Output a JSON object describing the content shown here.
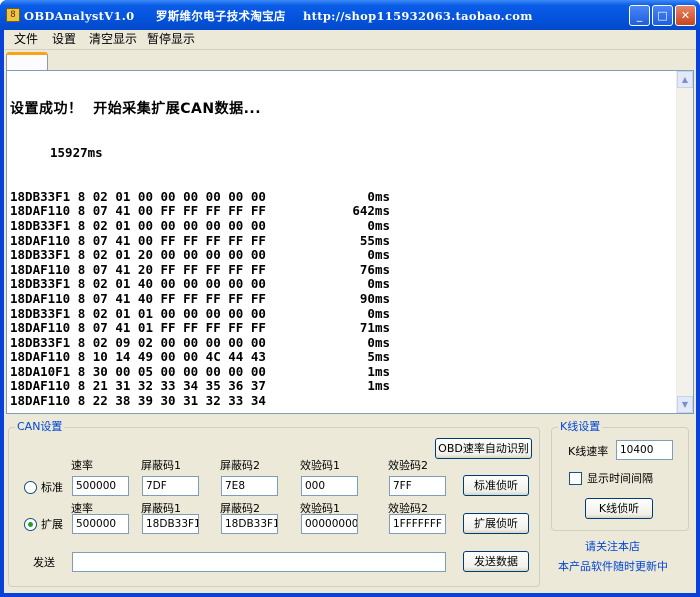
{
  "window": {
    "title": "OBDAnalystV1.0     罗斯维尔电子技术淘宝店    http://shop115932063.taobao.com",
    "min_glyph": "_",
    "max_glyph": "□",
    "close_glyph": "✕",
    "icon_glyph": "8"
  },
  "menu": {
    "items": [
      "文件",
      "设置",
      "清空显示",
      "暂停显示"
    ]
  },
  "log": {
    "header": "设置成功！  开始采集扩展CAN数据...",
    "first_time": "15927ms",
    "lines": [
      {
        "frame": "18DB33F1 8 02 01 00 00 00 00 00 00",
        "time": "0ms"
      },
      {
        "frame": "18DAF110 8 07 41 00 FF FF FF FF FF",
        "time": "642ms"
      },
      {
        "frame": "18DB33F1 8 02 01 00 00 00 00 00 00",
        "time": "0ms"
      },
      {
        "frame": "18DAF110 8 07 41 00 FF FF FF FF FF",
        "time": "55ms"
      },
      {
        "frame": "18DB33F1 8 02 01 20 00 00 00 00 00",
        "time": "0ms"
      },
      {
        "frame": "18DAF110 8 07 41 20 FF FF FF FF FF",
        "time": "76ms"
      },
      {
        "frame": "18DB33F1 8 02 01 40 00 00 00 00 00",
        "time": "0ms"
      },
      {
        "frame": "18DAF110 8 07 41 40 FF FF FF FF FF",
        "time": "90ms"
      },
      {
        "frame": "18DB33F1 8 02 01 01 00 00 00 00 00",
        "time": "0ms"
      },
      {
        "frame": "18DAF110 8 07 41 01 FF FF FF FF FF",
        "time": "71ms"
      },
      {
        "frame": "18DB33F1 8 02 09 02 00 00 00 00 00",
        "time": "0ms"
      },
      {
        "frame": "18DAF110 8 10 14 49 00 00 4C 44 43",
        "time": "5ms"
      },
      {
        "frame": "18DA10F1 8 30 00 05 00 00 00 00 00",
        "time": "1ms"
      },
      {
        "frame": "18DAF110 8 21 31 32 33 34 35 36 37",
        "time": "1ms"
      },
      {
        "frame": "18DAF110 8 22 38 39 30 31 32 33 34",
        "time": ""
      }
    ]
  },
  "can": {
    "group_label": "CAN设置",
    "auto_detect_button": "OBD速率自动识别",
    "standard": {
      "radio_label": "标准",
      "rate_label": "速率",
      "rate_value": "500000",
      "mask1_label": "屏蔽码1",
      "mask1_value": "7DF",
      "mask2_label": "屏蔽码2",
      "mask2_value": "7E8",
      "check1_label": "效验码1",
      "check1_value": "000",
      "check2_label": "效验码2",
      "check2_value": "7FF",
      "listen_button": "标准侦听",
      "selected": false
    },
    "extended": {
      "radio_label": "扩展",
      "rate_label": "速率",
      "rate_value": "500000",
      "mask1_label": "屏蔽码1",
      "mask1_value": "18DB33F1",
      "mask2_label": "屏蔽码2",
      "mask2_value": "18DB33F1",
      "check1_label": "效验码1",
      "check1_value": "00000000",
      "check2_label": "效验码2",
      "check2_value": "1FFFFFFF",
      "listen_button": "扩展侦听",
      "selected": true
    },
    "send_label": "发送",
    "send_value": "",
    "send_button": "发送数据"
  },
  "k": {
    "group_label": "K线设置",
    "rate_label": "K线速率",
    "rate_value": "10400",
    "show_interval_label": "显示时间间隔",
    "show_interval_checked": false,
    "listen_button": "K线侦听"
  },
  "footer": {
    "follow": "请关注本店",
    "update": "本产品软件随时更新中"
  },
  "colors": {
    "title_blue": "#0453dd",
    "group_label": "#0046d5",
    "face": "#ece9d8",
    "radio_dot": "#21a121",
    "tab_accent": "#f7a518"
  }
}
